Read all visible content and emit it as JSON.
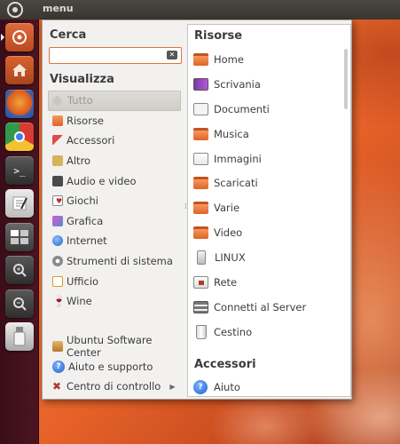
{
  "top_panel": {
    "menu_label": "menu"
  },
  "launcher": {
    "items": [
      "bfb-icon",
      "home-folder-icon",
      "firefox-icon",
      "chrome-icon",
      "terminal-icon",
      "text-editor-icon",
      "workspace-switcher-icon",
      "zoom-in-icon",
      "zoom-out-icon",
      "usb-drive-icon"
    ],
    "terminal_glyph": ">_"
  },
  "search": {
    "title": "Cerca",
    "value": "",
    "placeholder": ""
  },
  "view": {
    "title": "Visualizza",
    "categories": [
      {
        "label": "Tutto",
        "icon": "all-icon",
        "color": "#b9b7b2",
        "selected": true
      },
      {
        "label": "Risorse",
        "icon": "folder-icon",
        "color": "#e87a3a"
      },
      {
        "label": "Accessori",
        "icon": "accessories-icon",
        "color": "#c23a3a"
      },
      {
        "label": "Altro",
        "icon": "other-icon",
        "color": "#c9a04a"
      },
      {
        "label": "Audio e video",
        "icon": "multimedia-icon",
        "color": "#4a4a4a"
      },
      {
        "label": "Giochi",
        "icon": "games-icon",
        "color": "#c22a2a"
      },
      {
        "label": "Grafica",
        "icon": "graphics-icon",
        "color": "#d45ac8"
      },
      {
        "label": "Internet",
        "icon": "internet-icon",
        "color": "#3a7ad0"
      },
      {
        "label": "Strumenti di sistema",
        "icon": "system-tools-icon",
        "color": "#8a8a8a"
      },
      {
        "label": "Ufficio",
        "icon": "office-icon",
        "color": "#d69a2a"
      },
      {
        "label": "Wine",
        "icon": "wine-icon",
        "color": "#9a1a2a"
      }
    ]
  },
  "bottom": {
    "items": [
      {
        "label": "Ubuntu Software Center",
        "icon": "software-center-icon"
      },
      {
        "label": "Aiuto e supporto",
        "icon": "help-icon"
      },
      {
        "label": "Centro di controllo",
        "icon": "control-center-icon"
      }
    ]
  },
  "right": {
    "section1_title": "Risorse",
    "places": [
      {
        "label": "Home",
        "icon": "home-folder-icon"
      },
      {
        "label": "Scrivania",
        "icon": "desktop-folder-icon"
      },
      {
        "label": "Documenti",
        "icon": "documents-folder-icon"
      },
      {
        "label": "Musica",
        "icon": "music-folder-icon"
      },
      {
        "label": "Immagini",
        "icon": "pictures-folder-icon"
      },
      {
        "label": "Scaricati",
        "icon": "downloads-folder-icon"
      },
      {
        "label": "Varie",
        "icon": "folder-icon"
      },
      {
        "label": "Video",
        "icon": "videos-folder-icon"
      },
      {
        "label": "LINUX",
        "icon": "usb-drive-icon"
      },
      {
        "label": "Rete",
        "icon": "network-icon"
      },
      {
        "label": "Connetti al Server",
        "icon": "server-icon"
      },
      {
        "label": "Cestino",
        "icon": "trash-icon"
      }
    ],
    "section2_title": "Accessori",
    "accessories": [
      {
        "label": "Aiuto",
        "icon": "help-icon"
      }
    ]
  }
}
